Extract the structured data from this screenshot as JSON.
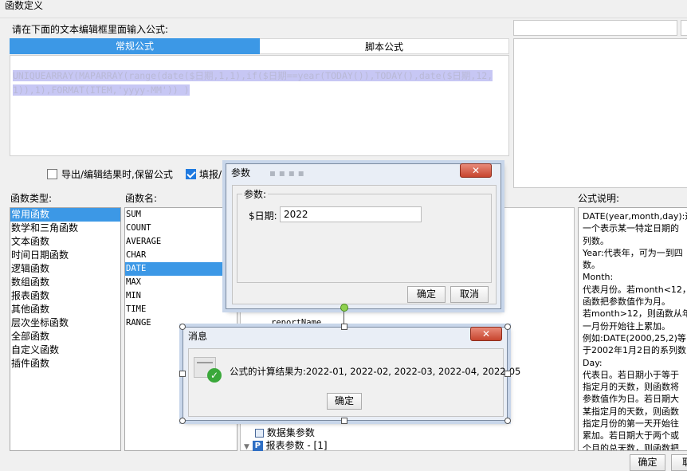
{
  "window": {
    "title": "函数定义"
  },
  "editor": {
    "prompt": "请在下面的文本编辑框里面输入公式:",
    "tabs": [
      "常规公式",
      "脚本公式"
    ],
    "formula_line1": "UNIQUEARRAY(MAPARRAY(range(date($日期,1,1),if($日期==year(TODAY()),TODAY(),date($日期,12,",
    "formula_line2": "1)),1),FORMAT(ITEM,'yyyy-MM')) )"
  },
  "options": {
    "keep_formula": "导出/编辑结果时,保留公式",
    "fill_partial": "填报/"
  },
  "function_types": {
    "header": "函数类型:",
    "items": [
      "常用函数",
      "数学和三角函数",
      "文本函数",
      "时间日期函数",
      "逻辑函数",
      "数组函数",
      "报表函数",
      "其他函数",
      "层次坐标函数",
      "全部函数",
      "自定义函数",
      "插件函数"
    ]
  },
  "function_names": {
    "header": "函数名:",
    "items": [
      "SUM",
      "COUNT",
      "AVERAGE",
      "CHAR",
      "DATE",
      "MAX",
      "MIN",
      "TIME",
      "RANGE"
    ]
  },
  "variables": {
    "partial_item": "reportName",
    "dataset_params": "数据集参数",
    "report_params": "报表参数 - [1]"
  },
  "description": {
    "header": "公式说明:",
    "lines": [
      "DATE(year,month,day):返",
      "一个表示某一特定日期的",
      "列数。",
      "Year:代表年，可为一到四",
      "数。",
      "Month:",
      "代表月份。若month<12，",
      "函数把参数值作为月。",
      "若month>12，则函数从年",
      "一月份开始往上累加。",
      "例如:DATE(2000,25,2)等",
      "于2002年1月2日的系列数",
      "Day:",
      "代表日。若日期小于等于",
      "指定月的天数，则函数将",
      "参数值作为日。若日期大",
      "某指定月的天数，则函数",
      "指定月份的第一天开始往",
      "累加。若日期大于两个或",
      "个月的总天数，则函数把"
    ]
  },
  "buttons": {
    "ok": "确定",
    "cancel": "取"
  },
  "param_dialog": {
    "title": "参数",
    "group": "参数:",
    "field_label": "$日期:",
    "field_value": "2022",
    "ok": "确定",
    "cancel": "取消"
  },
  "message_dialog": {
    "title": "消息",
    "message": "公式的计算结果为:2022-01, 2022-02, 2022-03, 2022-04, 2022-05",
    "ok": "确定"
  }
}
